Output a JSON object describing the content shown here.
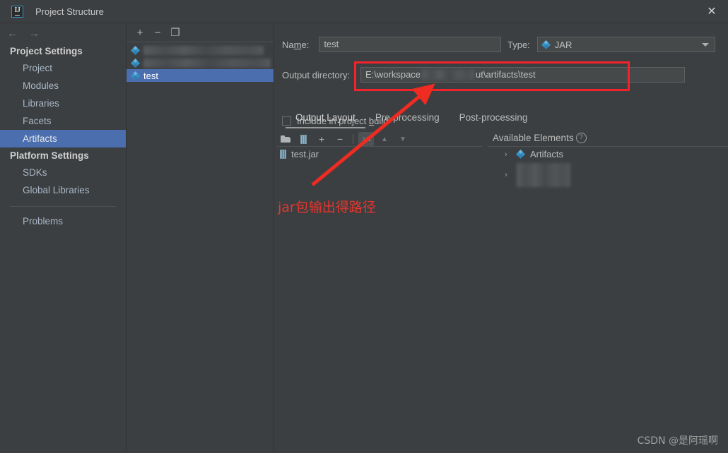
{
  "window": {
    "title": "Project Structure",
    "logo_text": "IJ",
    "close_icon": "✕"
  },
  "nav": {
    "back_icon": "←",
    "forward_icon": "→"
  },
  "sidebar": {
    "groups": [
      {
        "label": "Project Settings",
        "items": [
          {
            "label": "Project",
            "selected": false
          },
          {
            "label": "Modules",
            "selected": false
          },
          {
            "label": "Libraries",
            "selected": false
          },
          {
            "label": "Facets",
            "selected": false
          },
          {
            "label": "Artifacts",
            "selected": true
          }
        ]
      },
      {
        "label": "Platform Settings",
        "items": [
          {
            "label": "SDKs",
            "selected": false
          },
          {
            "label": "Global Libraries",
            "selected": false
          }
        ]
      }
    ],
    "footer_item": "Problems"
  },
  "artifact_tree": {
    "toolbar": {
      "add_label": "+",
      "remove_label": "−",
      "copy_label": "❐"
    },
    "items": [
      {
        "label": "",
        "blurred": true,
        "selected": false
      },
      {
        "label": "",
        "blurred": true,
        "selected": false
      },
      {
        "label": "test",
        "blurred": false,
        "selected": true
      }
    ]
  },
  "details": {
    "name_label": "Name:",
    "name_label_pre": "Na",
    "name_label_accel": "m",
    "name_label_post": "e:",
    "name_value": "test",
    "type_label": "Type:",
    "type_value": "JAR",
    "output_dir_label_pre": "O",
    "output_dir_label_post": "utput directory:",
    "output_dir_label": "Output directory:",
    "output_dir_value": "E:\\workspace          ut\\artifacts\\test",
    "output_dir_value_visible_a": "E:\\workspace",
    "output_dir_value_visible_b": "ut\\artifacts\\test",
    "browse_icon": "folder-open-icon",
    "include_checkbox_label_pre": "Include in project ",
    "include_checkbox_label_accel": "b",
    "include_checkbox_label_post": "uild",
    "include_checkbox_label": "Include in project build",
    "include_checked": false
  },
  "tabs": [
    {
      "label": "Output Layout",
      "active": true
    },
    {
      "label": "Pre-processing",
      "active": false
    },
    {
      "label": "Post-processing",
      "active": false
    }
  ],
  "output_layout": {
    "toolbar": [
      {
        "name": "create-directory-icon",
        "glyph": "📁"
      },
      {
        "name": "create-archive-icon",
        "glyph": "jar"
      },
      {
        "name": "add-icon",
        "glyph": "+"
      },
      {
        "name": "remove-icon",
        "glyph": "−"
      },
      {
        "name": "sort-icon",
        "glyph": "↓a"
      },
      {
        "name": "move-up-icon",
        "glyph": "▲"
      },
      {
        "name": "move-down-icon",
        "glyph": "▼"
      }
    ],
    "nodes": [
      {
        "label": "test.jar",
        "icon": "jar-icon"
      }
    ]
  },
  "available_elements": {
    "title": "Available Elements",
    "help_icon": "?",
    "nodes": [
      {
        "label": "Artifacts",
        "icon": "artifact-diamond-icon",
        "expand": "›",
        "blurred": false
      },
      {
        "label": "",
        "icon": "module-icon",
        "expand": "›",
        "blurred": true
      }
    ]
  },
  "annotations": {
    "highlight_color": "#f4222a",
    "note_text": "jar包输出得路径",
    "arrow": "red-arrow-pointing-to-output-directory"
  },
  "watermark": {
    "text": "CSDN @是阿瑶啊"
  }
}
